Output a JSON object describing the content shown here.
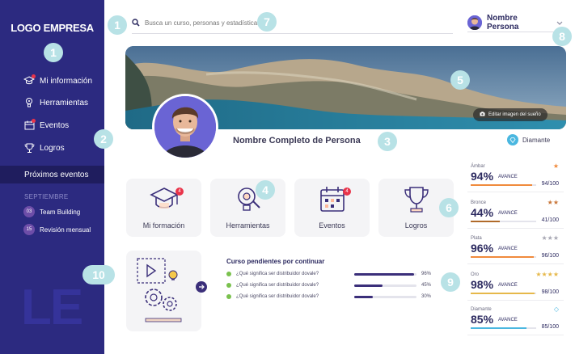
{
  "sidebar": {
    "logo": "LOGO EMPRESA",
    "items": [
      {
        "label": "Mi información"
      },
      {
        "label": "Herramientas"
      },
      {
        "label": "Eventos"
      },
      {
        "label": "Logros"
      }
    ],
    "events_title": "Próximos eventos",
    "month": "SEPTIEMBRE",
    "events": [
      {
        "day": "03",
        "name": "Team Building"
      },
      {
        "day": "15",
        "name": "Revisión mensual"
      }
    ],
    "watermark": "LE"
  },
  "search": {
    "placeholder": "Busca un curso, personas y estadísticas"
  },
  "user": {
    "name": "Nombre Persona"
  },
  "banner": {
    "edit_label": "Editar imagen del sueño"
  },
  "profile": {
    "full_name": "Nombre Completo de Persona",
    "rank": "Diamante"
  },
  "cards": [
    {
      "label": "Mi formación",
      "badge": "4"
    },
    {
      "label": "Herramientas",
      "badge": ""
    },
    {
      "label": "Eventos",
      "badge": "4"
    },
    {
      "label": "Logros",
      "badge": ""
    }
  ],
  "pending": {
    "title": "Curso pendientes por continuar",
    "courses": [
      {
        "question": "¿Qué significa ser distribuidor dovale?",
        "percent": "96%",
        "progress": 96
      },
      {
        "question": "¿Qué significa ser distribuidor dovale?",
        "percent": "45%",
        "progress": 45
      },
      {
        "question": "¿Qué significa ser distribuidor dovale?",
        "percent": "30%",
        "progress": 30
      }
    ]
  },
  "levels": [
    {
      "name": "Ámbar",
      "percent": "94%",
      "avance": "AVANCE",
      "score": "94/100",
      "progress": 94,
      "color": "#f08a3c",
      "stars": "★",
      "star_color": "#f08a3c"
    },
    {
      "name": "Bronce",
      "percent": "44%",
      "avance": "AVANCE",
      "score": "41/100",
      "progress": 44,
      "color": "#b06a2a",
      "stars": "★★",
      "star_color": "#c9773a"
    },
    {
      "name": "Plata",
      "percent": "96%",
      "avance": "AVANCE",
      "score": "96/100",
      "progress": 96,
      "color": "#f08a3c",
      "stars": "★★★",
      "star_color": "#a8a8b4"
    },
    {
      "name": "Oro",
      "percent": "98%",
      "avance": "AVANCE",
      "score": "98/100",
      "progress": 98,
      "color": "#e6b84a",
      "stars": "★★★★",
      "star_color": "#e6b84a"
    },
    {
      "name": "Diamante",
      "percent": "85%",
      "avance": "AVANCE",
      "score": "85/100",
      "progress": 85,
      "color": "#4ab7e0",
      "stars": "◇",
      "star_color": "#4ab7e0"
    }
  ],
  "markers": [
    "1",
    "1",
    "2",
    "3",
    "4",
    "5",
    "6",
    "7",
    "8",
    "9",
    "10"
  ],
  "colors": {
    "sidebar": "#2c2a80",
    "accent": "#3b2f7a",
    "marker": "#b8e2e6",
    "notify": "#e9344a"
  }
}
